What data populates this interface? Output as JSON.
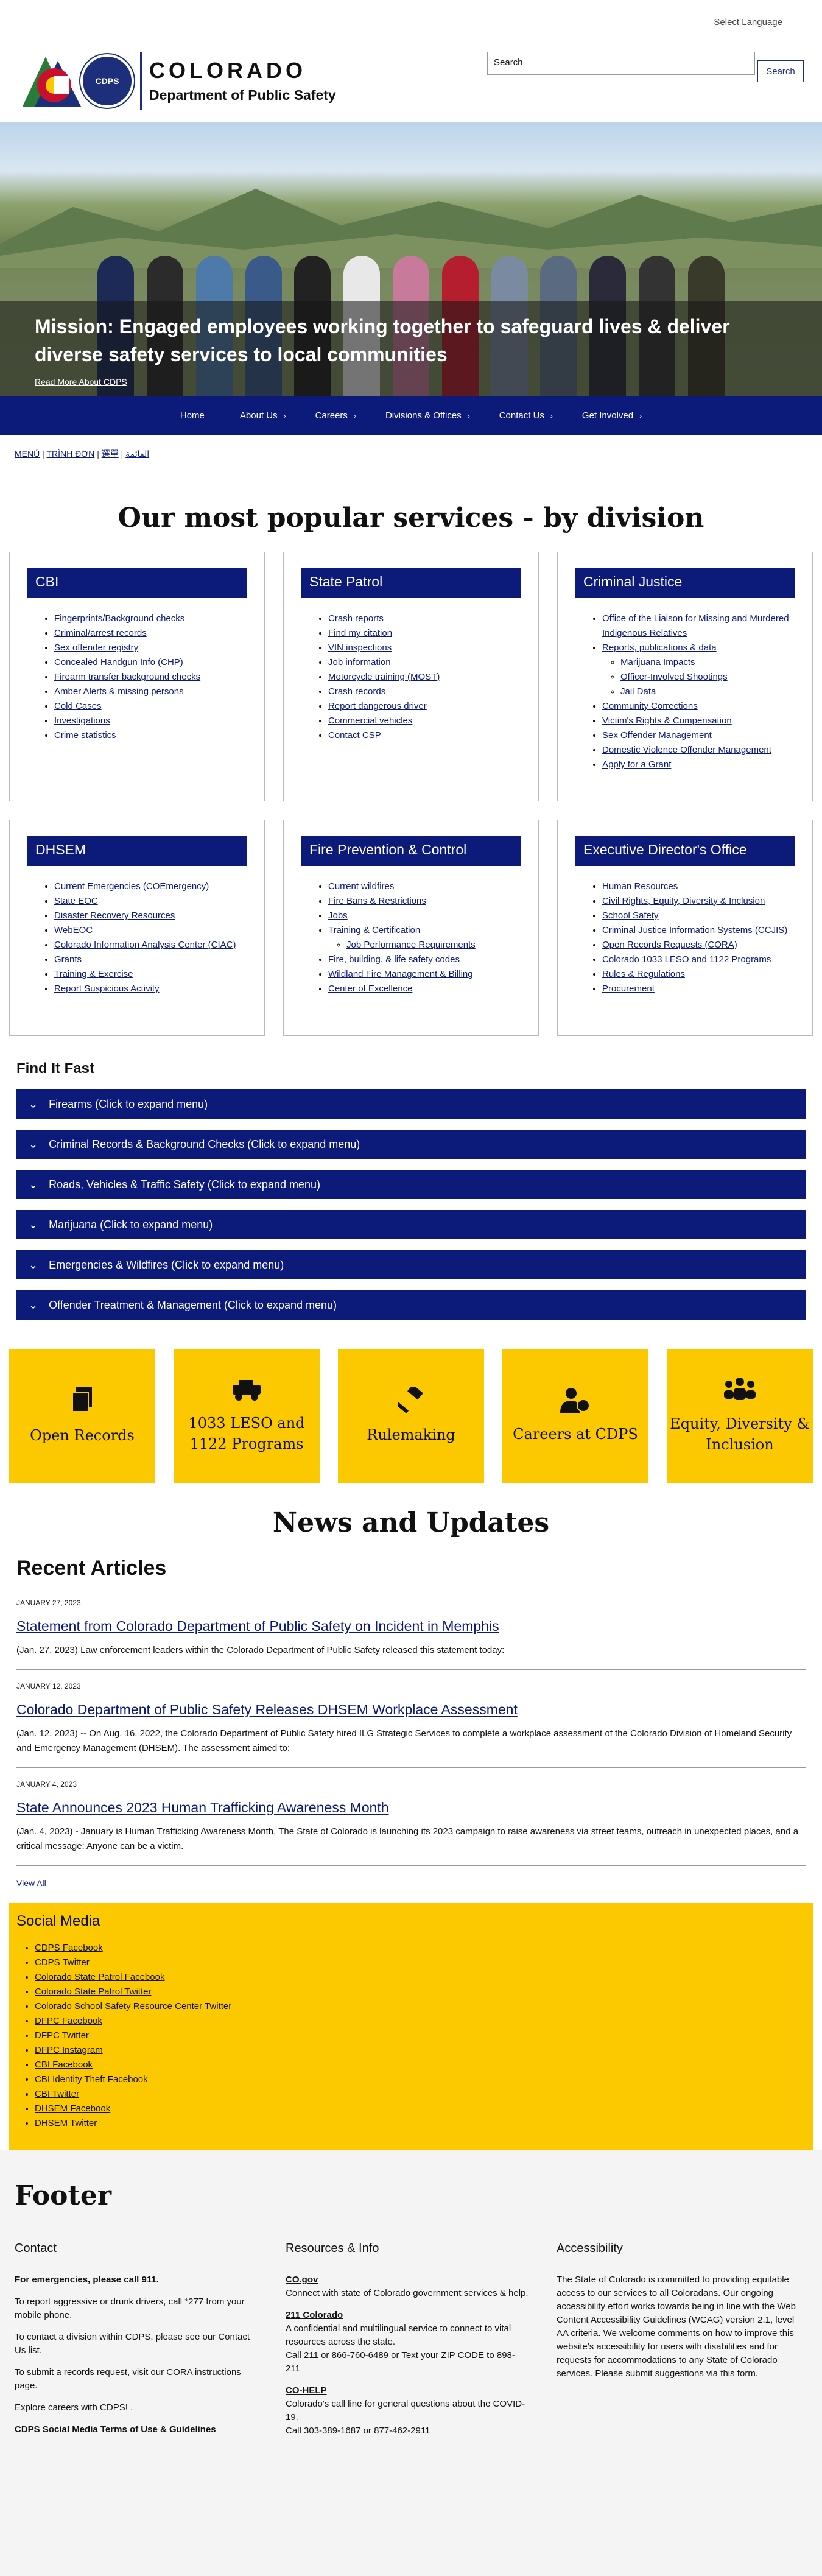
{
  "header": {
    "language": "Select Language",
    "logo_title": "COLORADO",
    "logo_subtitle": "Department of Public Safety",
    "logo_badge": "CDPS",
    "search_placeholder": "Search",
    "search_button": "Search"
  },
  "hero": {
    "mission": "Mission: Engaged employees working together to safeguard lives & deliver diverse safety services to local communities",
    "link": "Read More About CDPS"
  },
  "nav": [
    {
      "label": "Home",
      "chev": ""
    },
    {
      "label": "About Us",
      "chev": "›"
    },
    {
      "label": "Careers",
      "chev": "›"
    },
    {
      "label": "Divisions & Offices",
      "chev": "›"
    },
    {
      "label": "Contact Us",
      "chev": "›"
    },
    {
      "label": "Get Involved",
      "chev": "›"
    }
  ],
  "lang_links": [
    "MENÚ",
    "TRÌNH ĐƠN",
    "選單",
    "القائمة"
  ],
  "services": {
    "title": "Our most popular services - by division",
    "cards": [
      {
        "name": "CBI",
        "items": [
          "Fingerprints/Background checks",
          "Criminal/arrest records",
          "Sex offender registry",
          "Concealed Handgun Info (CHP)",
          "Firearm transfer background checks",
          "Amber Alerts & missing persons",
          "Cold Cases",
          "Investigations",
          "Crime statistics"
        ]
      },
      {
        "name": "State Patrol",
        "items": [
          "Crash reports",
          "Find my citation",
          "VIN inspections",
          "Job information",
          "Motorcycle training (MOST)",
          "Crash records",
          "Report dangerous driver",
          "Commercial vehicles",
          "Contact CSP"
        ]
      },
      {
        "name": "Criminal Justice",
        "items": [
          "Office of the Liaison for Missing and Murdered Indigenous Relatives",
          "Reports, publications & data",
          "Community Corrections",
          "Victim's Rights & Compensation",
          "Sex Offender Management",
          "Domestic Violence Offender Management",
          "Apply for a Grant"
        ],
        "sub": [
          "Marijuana Impacts",
          "Officer-Involved Shootings",
          "Jail Data"
        ]
      },
      {
        "name": "DHSEM",
        "items": [
          "Current Emergencies (COEmergency)",
          "State EOC",
          "Disaster Recovery Resources",
          "WebEOC",
          "Colorado Information Analysis Center (CIAC)",
          "Grants",
          "Training & Exercise",
          "Report Suspicious Activity"
        ]
      },
      {
        "name": "Fire Prevention & Control",
        "items": [
          "Current wildfires",
          "Fire Bans & Restrictions",
          "Jobs",
          "Training & Certification",
          "Fire, building, & life safety codes",
          "Wildland Fire Management & Billing",
          "Center of Excellence"
        ],
        "sub": [
          "Job Performance Requirements"
        ]
      },
      {
        "name": "Executive Director's Office",
        "items": [
          "Human Resources",
          "Civil Rights, Equity, Diversity & Inclusion",
          "School Safety",
          "Criminal Justice Information Systems (CCJIS)",
          "Open Records Requests (CORA)",
          "Colorado 1033 LESO and 1122 Programs",
          "Rules & Regulations",
          "Procurement"
        ]
      }
    ]
  },
  "find_it_fast": {
    "title": "Find It Fast",
    "items": [
      "Firearms (Click to expand menu)",
      "Criminal Records & Background Checks (Click to expand menu)",
      "Roads, Vehicles & Traffic Safety (Click to expand menu)",
      "Marijuana (Click to expand menu)",
      "Emergencies & Wildfires (Click to expand menu)",
      "Offender Treatment & Management (Click to expand menu)"
    ]
  },
  "tiles": [
    {
      "label": "Open Records",
      "icon": "documents-icon"
    },
    {
      "label": "1033 LESO and 1122 Programs",
      "icon": "vehicle-icon"
    },
    {
      "label": "Rulemaking",
      "icon": "gavel-icon"
    },
    {
      "label": "Careers at CDPS",
      "icon": "user-clock-icon"
    },
    {
      "label": "Equity, Diversity & Inclusion",
      "icon": "people-icon"
    }
  ],
  "news": {
    "title": "News and Updates",
    "recent": "Recent Articles",
    "articles": [
      {
        "date": "JANUARY 27, 2023",
        "title": "Statement from Colorado Department of Public Safety on Incident in Memphis",
        "body": "(Jan. 27, 2023) Law enforcement leaders within the Colorado Department of Public Safety released this statement today:"
      },
      {
        "date": "JANUARY 12, 2023",
        "title": "Colorado Department of Public Safety Releases DHSEM Workplace Assessment",
        "body": "(Jan. 12, 2023) -- On Aug. 16, 2022, the Colorado Department of Public Safety hired ILG Strategic Services to complete a workplace assessment of the Colorado Division of Homeland Security and Emergency Management (DHSEM). The assessment aimed to:"
      },
      {
        "date": "JANUARY 4, 2023",
        "title": "State Announces 2023 Human Trafficking Awareness Month",
        "body": "(Jan. 4, 2023) - January is Human Trafficking Awareness Month. The State of Colorado is launching its 2023 campaign to raise awareness via street teams, outreach in unexpected places, and a critical message: Anyone can be a victim."
      }
    ],
    "view_all": "View All"
  },
  "social": {
    "title": "Social Media",
    "links": [
      "CDPS Facebook",
      "CDPS Twitter",
      "Colorado State Patrol Facebook",
      "Colorado State Patrol Twitter",
      "Colorado School Safety Resource Center Twitter",
      "DFPC Facebook",
      "DFPC Twitter",
      "DFPC Instagram",
      "CBI Facebook",
      "CBI Identity Theft Facebook",
      "CBI Twitter",
      "DHSEM Facebook",
      "DHSEM Twitter"
    ]
  },
  "footer": {
    "title": "Footer",
    "contact": {
      "title": "Contact",
      "p1": "For emergencies, please call 911.",
      "p2": "To report aggressive or drunk drivers, call *277 from your mobile phone.",
      "p3": "To contact a division within CDPS, please see our Contact Us list.",
      "p4": "To submit a records request, visit our CORA instructions page.",
      "p5": "Explore careers with CDPS! .",
      "p6": "CDPS Social Media Terms of Use & Guidelines"
    },
    "resources": {
      "title": "Resources & Info",
      "r1_link": "CO.gov",
      "r1_text": "Connect with state of Colorado government services & help.",
      "r2_link": "211 Colorado",
      "r2_text": "A confidential and multilingual service to connect to vital resources across the state.",
      "r2_call": "Call 211 or 866-760-6489 or Text your ZIP CODE to 898-211",
      "r3_link": "CO-HELP",
      "r3_text": "Colorado's call line for general questions about the COVID-19.",
      "r3_call": "Call 303-389-1687 or 877-462-2911"
    },
    "accessibility": {
      "title": "Accessibility",
      "text": "The State of Colorado is committed to providing equitable access to our services to all Coloradans. Our ongoing accessibility effort works towards being in line with the Web Content Accessibility Guidelines (WCAG) version 2.1, level AA criteria. We welcome comments on how to improve this website's accessibility for users with disabilities and for requests for accommodations to any State of Colorado services.",
      "link": "Please submit suggestions via this form."
    }
  }
}
